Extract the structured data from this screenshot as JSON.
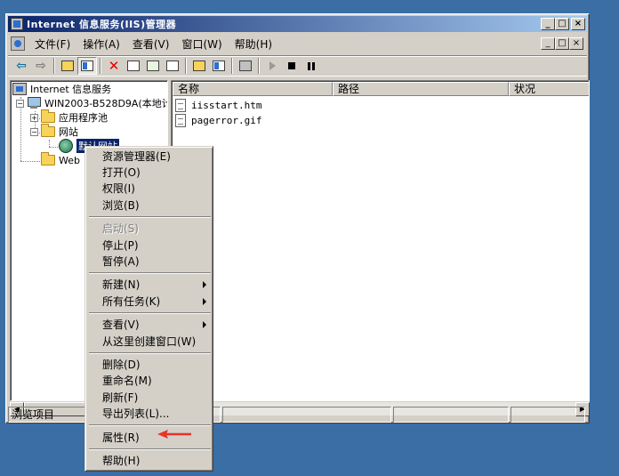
{
  "window": {
    "title": "Internet 信息服务(IIS)管理器",
    "buttons": {
      "minimize": "_",
      "maximize": "□",
      "close": "×"
    }
  },
  "menubar": {
    "items": [
      "文件(F)",
      "操作(A)",
      "查看(V)",
      "窗口(W)",
      "帮助(H)"
    ]
  },
  "toolbar": {
    "icons": [
      "back-arrow-icon",
      "forward-arrow-icon",
      "up-folder-icon",
      "show-tree-icon",
      "delete-icon",
      "properties-icon",
      "refresh-icon",
      "export-list-icon",
      "help-icon",
      "mmc-icon",
      "computer-icon",
      "start-icon",
      "stop-icon",
      "pause-icon"
    ]
  },
  "tree": {
    "root": "Internet 信息服务",
    "server": "WIN2003-B528D9A(本地计",
    "app_pools": "应用程序池",
    "websites": "网站",
    "default_site": "默认网站",
    "web_ext": "Web"
  },
  "list": {
    "columns": [
      "名称",
      "路径",
      "状况"
    ],
    "files": [
      "iisstart.htm",
      "pagerror.gif"
    ]
  },
  "context_menu": {
    "groups": [
      [
        {
          "label": "资源管理器(E)",
          "disabled": false
        },
        {
          "label": "打开(O)",
          "disabled": false
        },
        {
          "label": "权限(I)",
          "disabled": false
        },
        {
          "label": "浏览(B)",
          "disabled": false
        }
      ],
      [
        {
          "label": "启动(S)",
          "disabled": true
        },
        {
          "label": "停止(P)",
          "disabled": false
        },
        {
          "label": "暂停(A)",
          "disabled": false
        }
      ],
      [
        {
          "label": "新建(N)",
          "disabled": false,
          "submenu": true
        },
        {
          "label": "所有任务(K)",
          "disabled": false,
          "submenu": true
        }
      ],
      [
        {
          "label": "查看(V)",
          "disabled": false,
          "submenu": true
        },
        {
          "label": "从这里创建窗口(W)",
          "disabled": false
        }
      ],
      [
        {
          "label": "删除(D)",
          "disabled": false
        },
        {
          "label": "重命名(M)",
          "disabled": false
        },
        {
          "label": "刷新(F)",
          "disabled": false
        },
        {
          "label": "导出列表(L)...",
          "disabled": false
        }
      ],
      [
        {
          "label": "属性(R)",
          "disabled": false
        }
      ],
      [
        {
          "label": "帮助(H)",
          "disabled": false
        }
      ]
    ]
  },
  "statusbar": {
    "text": "浏览项目"
  },
  "colors": {
    "annotation_arrow": "#e8332a",
    "selection": "#0a246a",
    "desktop": "#3a6ea5"
  }
}
